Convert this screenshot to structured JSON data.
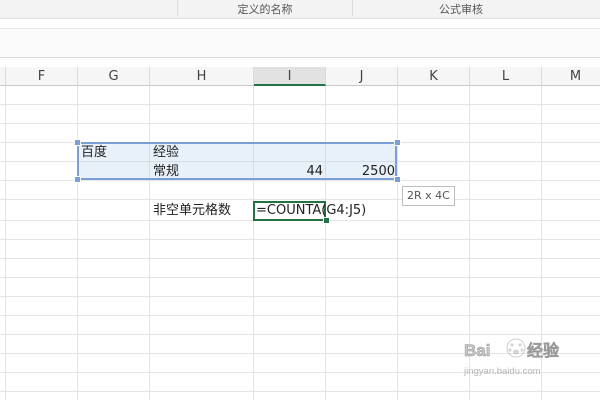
{
  "ribbon": {
    "group_defined_names": "定义的名称",
    "group_formula_audit": "公式审核"
  },
  "columns": [
    "F",
    "G",
    "H",
    "I",
    "J",
    "K",
    "L",
    "M"
  ],
  "selected_column": "I",
  "cells": {
    "G4": "百度",
    "H4": "经验",
    "H5": "常规",
    "I5": "44",
    "J5": "2500",
    "H7": "非空单元格数",
    "I7": "=COUNTA(G4:J5)"
  },
  "selection": {
    "range": "G4:J5",
    "size_tooltip": "2R x 4C"
  },
  "colors": {
    "accent_green": "#217346",
    "selection_border": "#7a9fd6"
  },
  "watermark": {
    "text": "Bai 经验",
    "url": "jingyan.baidu.com"
  }
}
